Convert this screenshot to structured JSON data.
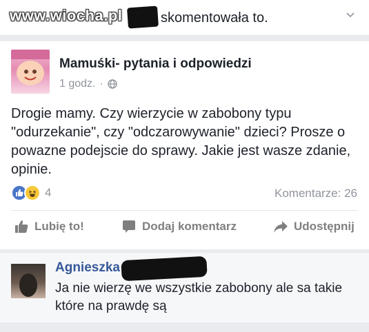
{
  "notification": {
    "watermark": "www.wiocha.pl",
    "action_text": "skomentowała to."
  },
  "post": {
    "group_name": "Mamuśki- pytania i odpowiedzi",
    "time": "1 godz.",
    "separator": "·",
    "body": "Drogie mamy. Czy wierzycie w zabobony typu \"odurzekanie\", czy \"odczarowywanie\" dzieci? Prosze o powazne podejscie do sprawy.  Jakie jest wasze zdanie, opinie.",
    "reactions_count": "4",
    "comments_count": "Komentarze: 26"
  },
  "actions": {
    "like": "Lubię to!",
    "comment": "Dodaj komentarz",
    "share": "Udostępnij"
  },
  "comment": {
    "author": "Agnieszka",
    "text": "Ja nie wierzę we wszystkie zabobony ale sa takie które na prawdę są"
  },
  "icons": {
    "chevron": "chevron-down-icon",
    "globe": "globe-icon",
    "like_reaction": "like-reaction-icon",
    "haha_reaction": "haha-reaction-icon",
    "like": "thumbs-up-icon",
    "comment": "comment-bubble-icon",
    "share": "share-arrow-icon"
  },
  "colors": {
    "link": "#365899",
    "muted": "#90949c",
    "text": "#1d2129",
    "like_blue": "#4a76c9",
    "haha_yellow": "#f7c93b"
  }
}
